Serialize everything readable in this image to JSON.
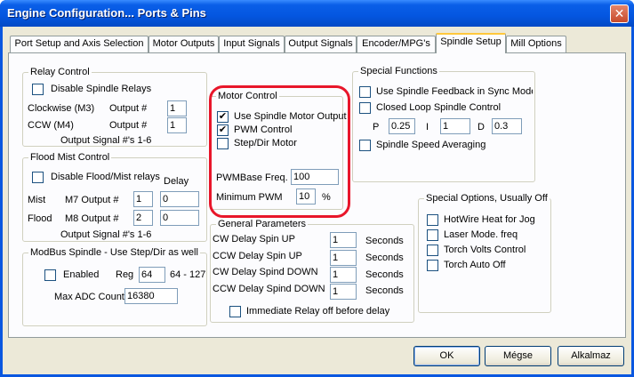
{
  "window": {
    "title": "Engine Configuration... Ports & Pins",
    "close_glyph": "✕"
  },
  "tabs": [
    {
      "label": "Port Setup and Axis Selection"
    },
    {
      "label": "Motor Outputs"
    },
    {
      "label": "Input Signals"
    },
    {
      "label": "Output Signals"
    },
    {
      "label": "Encoder/MPG's"
    },
    {
      "label": "Spindle Setup"
    },
    {
      "label": "Mill Options"
    }
  ],
  "relay_control": {
    "title": "Relay Control",
    "disable_label": "Disable Spindle Relays",
    "cw_label": "Clockwise (M3)",
    "cw_output_label": "Output #",
    "cw_value": "1",
    "ccw_label": "CCW (M4)",
    "ccw_output_label": "Output #",
    "ccw_value": "1",
    "footer": "Output Signal #'s 1-6"
  },
  "flood_mist": {
    "title": "Flood Mist Control",
    "disable_label": "Disable Flood/Mist relays",
    "delay_label": "Delay",
    "mist_label": "Mist",
    "mist_output_label": "M7 Output #",
    "mist_output": "1",
    "mist_delay": "0",
    "flood_label": "Flood",
    "flood_output_label": "M8 Output #",
    "flood_output": "2",
    "flood_delay": "0",
    "footer": "Output Signal #'s 1-6"
  },
  "modbus": {
    "title": "ModBus Spindle - Use Step/Dir as well",
    "enabled_label": "Enabled",
    "reg_label": "Reg",
    "reg_value": "64",
    "reg_range": "64 - 127",
    "max_adc_label": "Max ADC Count",
    "max_adc_value": "16380"
  },
  "motor_control": {
    "title": "Motor Control",
    "use_spindle_label": "Use Spindle Motor Output",
    "use_spindle_checked": true,
    "pwm_label": "PWM Control",
    "pwm_checked": true,
    "stepdir_label": "Step/Dir Motor",
    "stepdir_checked": false,
    "pwm_base_label": "PWMBase Freq.",
    "pwm_base_value": "100",
    "min_pwm_label": "Minimum PWM",
    "min_pwm_value": "10",
    "min_pwm_unit": "%"
  },
  "general": {
    "title": "General Parameters",
    "rows": [
      {
        "label": "CW Delay Spin UP",
        "value": "1",
        "unit": "Seconds"
      },
      {
        "label": "CCW Delay Spin UP",
        "value": "1",
        "unit": "Seconds"
      },
      {
        "label": "CW Delay Spind DOWN",
        "value": "1",
        "unit": "Seconds"
      },
      {
        "label": "CCW Delay Spind DOWN",
        "value": "1",
        "unit": "Seconds"
      }
    ],
    "immediate_label": "Immediate Relay off before delay"
  },
  "special_functions": {
    "title": "Special Functions",
    "feedback_label": "Use Spindle Feedback in Sync Modes",
    "closed_loop_label": "Closed Loop Spindle Control",
    "p_label": "P",
    "p_value": "0.25",
    "i_label": "I",
    "i_value": "1",
    "d_label": "D",
    "d_value": "0.3",
    "averaging_label": "Spindle Speed Averaging"
  },
  "special_options": {
    "title": "Special Options, Usually Off",
    "items": [
      {
        "label": "HotWire Heat for Jog"
      },
      {
        "label": "Laser Mode. freq"
      },
      {
        "label": "Torch Volts Control"
      },
      {
        "label": "Torch Auto Off"
      }
    ]
  },
  "buttons": {
    "ok": "OK",
    "cancel": "Mégse",
    "apply": "Alkalmaz"
  },
  "colors": {
    "title_bar": "#0456e0",
    "highlight": "#e8162a",
    "active_tab_accent": "#ffc83c"
  }
}
